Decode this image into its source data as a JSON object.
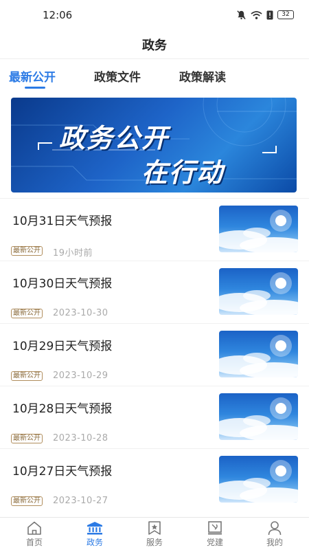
{
  "status": {
    "time": "12:06",
    "battery": "32"
  },
  "header": {
    "title": "政务"
  },
  "tabs": [
    {
      "label": "最新公开",
      "active": true
    },
    {
      "label": "政策文件",
      "active": false
    },
    {
      "label": "政策解读",
      "active": false
    }
  ],
  "banner": {
    "line1": "政务公开",
    "line2": "在行动"
  },
  "items": [
    {
      "title": "10月31日天气预报",
      "tag": "最新公开",
      "date": "19小时前"
    },
    {
      "title": "10月30日天气预报",
      "tag": "最新公开",
      "date": "2023-10-30"
    },
    {
      "title": "10月29日天气预报",
      "tag": "最新公开",
      "date": "2023-10-29"
    },
    {
      "title": "10月28日天气预报",
      "tag": "最新公开",
      "date": "2023-10-28"
    },
    {
      "title": "10月27日天气预报",
      "tag": "最新公开",
      "date": "2023-10-27"
    }
  ],
  "bottom_nav": [
    {
      "label": "首页",
      "icon": "home-icon",
      "active": false
    },
    {
      "label": "政务",
      "icon": "government-icon",
      "active": true
    },
    {
      "label": "服务",
      "icon": "bookmark-star-icon",
      "active": false
    },
    {
      "label": "党建",
      "icon": "party-icon",
      "active": false
    },
    {
      "label": "我的",
      "icon": "user-icon",
      "active": false
    }
  ],
  "colors": {
    "accent": "#2c7be5",
    "tag": "#8a6a3a"
  }
}
